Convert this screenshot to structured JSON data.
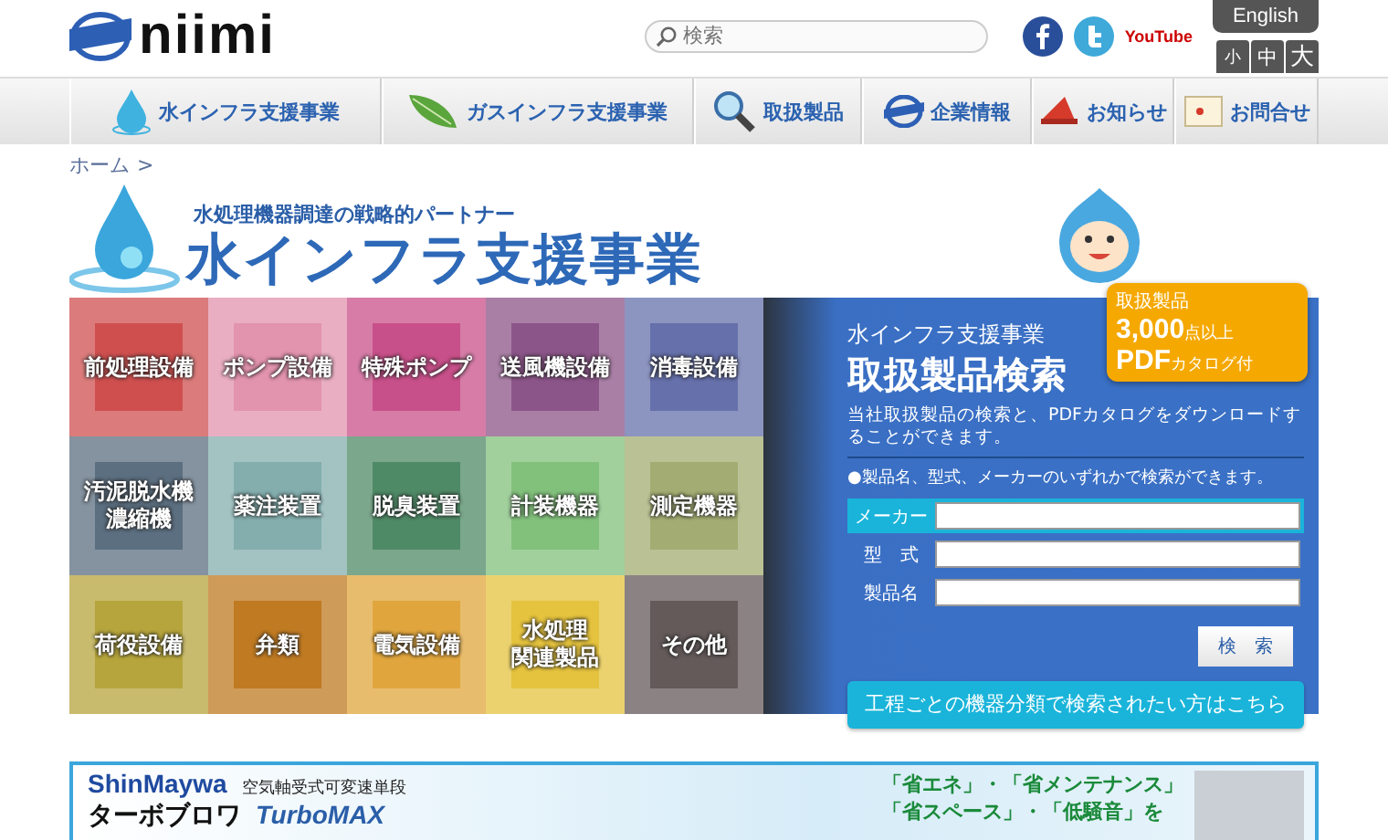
{
  "header": {
    "logo": "niimi",
    "search": {
      "placeholder": "検索"
    },
    "youtube": "YouTube",
    "language_button": "English",
    "font_sizes": [
      "小",
      "中",
      "大"
    ]
  },
  "nav": [
    {
      "label": "水インフラ支援事業",
      "kind": "drop"
    },
    {
      "label": "ガスインフラ支援事業",
      "kind": "leaf"
    },
    {
      "label": "取扱製品",
      "kind": "magnifier"
    },
    {
      "label": "企業情報",
      "kind": "globe"
    },
    {
      "label": "お知らせ",
      "kind": "megaphone"
    },
    {
      "label": "お問合せ",
      "kind": "card"
    }
  ],
  "breadcrumb": [
    "ホーム",
    ">"
  ],
  "hero": {
    "subtitle": "水処理機器調達の戦略的パートナー",
    "title": "水インフラ支援事業"
  },
  "categories": [
    {
      "label": "前処理設備",
      "color": "#cf4f4f"
    },
    {
      "label": "ポンプ設備",
      "color": "#e293ae"
    },
    {
      "label": "特殊ポンプ",
      "color": "#c8508a"
    },
    {
      "label": "送風機設備",
      "color": "#8c5589"
    },
    {
      "label": "消毒設備",
      "color": "#6670ab"
    },
    {
      "label": [
        "汚泥脱水機",
        "濃縮機"
      ],
      "color": "#5c6f80"
    },
    {
      "label": "薬注装置",
      "color": "#84aeae"
    },
    {
      "label": "脱臭装置",
      "color": "#4f8a66"
    },
    {
      "label": "計装機器",
      "color": "#82c17c"
    },
    {
      "label": "測定機器",
      "color": "#a3ac72"
    },
    {
      "label": "荷役設備",
      "color": "#b6a53c"
    },
    {
      "label": "弁類",
      "color": "#bf7a22"
    },
    {
      "label": "電気設備",
      "color": "#e0a63d"
    },
    {
      "label": [
        "水処理",
        "関連製品"
      ],
      "color": "#e5c33e"
    },
    {
      "label": "その他",
      "color": "#645a5a"
    }
  ],
  "search_panel": {
    "kicker": "水インフラ支援事業",
    "title": "取扱製品検索",
    "description": "当社取扱製品の検索と、PDFカタログをダウンロードすることができます。",
    "note": "●製品名、型式、メーカーのいずれかで検索ができます。",
    "fields": [
      {
        "label": "メーカー",
        "focused": true
      },
      {
        "label": "型　式",
        "focused": false
      },
      {
        "label": "製品名",
        "focused": false
      }
    ],
    "button": "検　索",
    "badge": {
      "line_1": "取扱製品",
      "count": "3,000",
      "count_suffix": "点以上",
      "pdf": "PDF",
      "pdf_suffix": "カタログ付"
    },
    "category_link": "工程ごとの機器分類で検索されたい方はこちら"
  },
  "banner": {
    "brand": "ShinMaywa",
    "subtitle": "空気軸受式可変速単段",
    "product": "ターボブロワ",
    "product_name": "TurboMAX",
    "features_1": "「省エネ」・「省メンテナンス」",
    "features_2": "「省スペース」・「低騒音」を"
  }
}
